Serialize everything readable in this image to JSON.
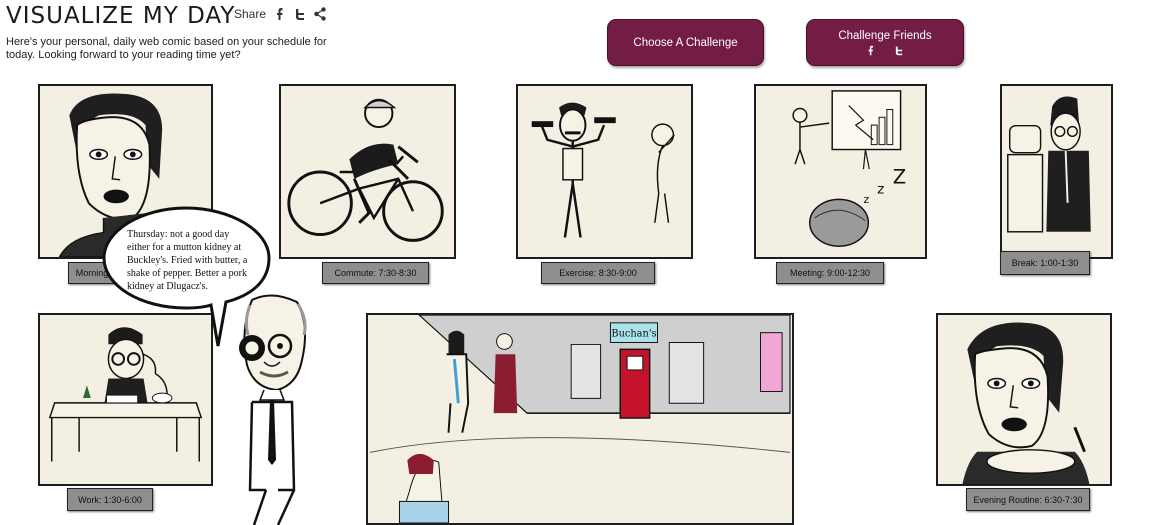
{
  "header": {
    "title": "VISUALIZE MY DAY",
    "share_label": "Share",
    "share_icons": [
      "facebook-icon",
      "twitter-icon",
      "share-icon"
    ],
    "intro": "Here's your personal, daily web comic based on your schedule for today. Looking forward to your reading time yet?"
  },
  "actions": {
    "choose_label": "Choose A Challenge",
    "friends_label": "Challenge Friends",
    "friends_icons": [
      "facebook-icon",
      "twitter-icon"
    ]
  },
  "brand_color": "#731d45",
  "panels": [
    {
      "caption": "Morning",
      "scene": "woman-portrait"
    },
    {
      "caption": "Commute: 7:30-8:30",
      "scene": "cyclist"
    },
    {
      "caption": "Exercise: 8:30-9:00",
      "scene": "dumbbells"
    },
    {
      "caption": "Meeting: 9:00-12:30",
      "scene": "presentation-sleeping"
    },
    {
      "caption": "Break: 1:00-1:30",
      "scene": "water-cooler"
    },
    {
      "caption": "Work: 1:30-6:00",
      "scene": "desk-phone"
    },
    {
      "caption": "",
      "scene": "street-bakery"
    },
    {
      "caption": "Evening Routine: 6:30-7:30",
      "scene": "woman-dinner"
    }
  ],
  "speech_bubble": {
    "text": "Thursday: not a good day either for a mutton kidney at Buckley's. Fried with butter, a shake of pepper. Better a pork kidney at Dlugacz's."
  },
  "street_sign": "Buchan's"
}
